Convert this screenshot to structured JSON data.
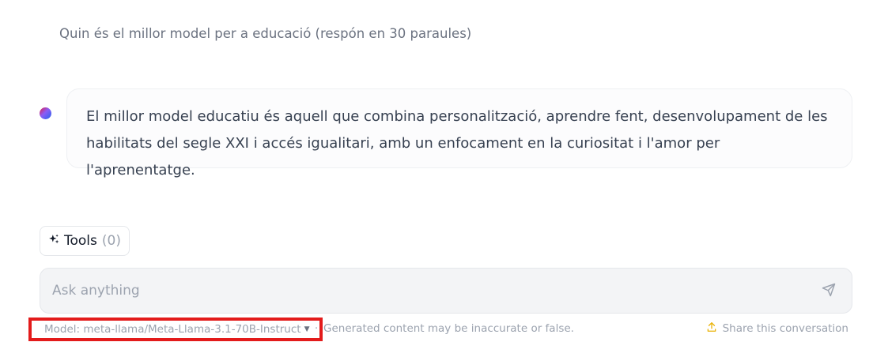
{
  "conversation": {
    "user_message": "Quin és el millor model per a educació (respón en 30 paraules)",
    "assistant_message": "El millor model educatiu és aquell que combina personalització, aprendre fent, desenvolupament de les habilitats del segle XXI i accés igualitari, amb un enfocament en la curiositat i l'amor per l'aprenentatge."
  },
  "tools": {
    "label": "Tools",
    "count": "(0)",
    "icon": "sparkles-icon"
  },
  "input": {
    "placeholder": "Ask anything",
    "value": "",
    "send_icon": "send-icon"
  },
  "footer": {
    "model_label": "Model: meta-llama/Meta-Llama-3.1-70B-Instruct",
    "separator": "·",
    "disclaimer": "Generated content may be inaccurate or false.",
    "share_label": "Share this conversation",
    "share_icon": "share-upload-icon"
  },
  "colors": {
    "highlight_border": "#e31b1b",
    "share_icon": "#eab308",
    "input_bg": "#f3f4f6"
  }
}
